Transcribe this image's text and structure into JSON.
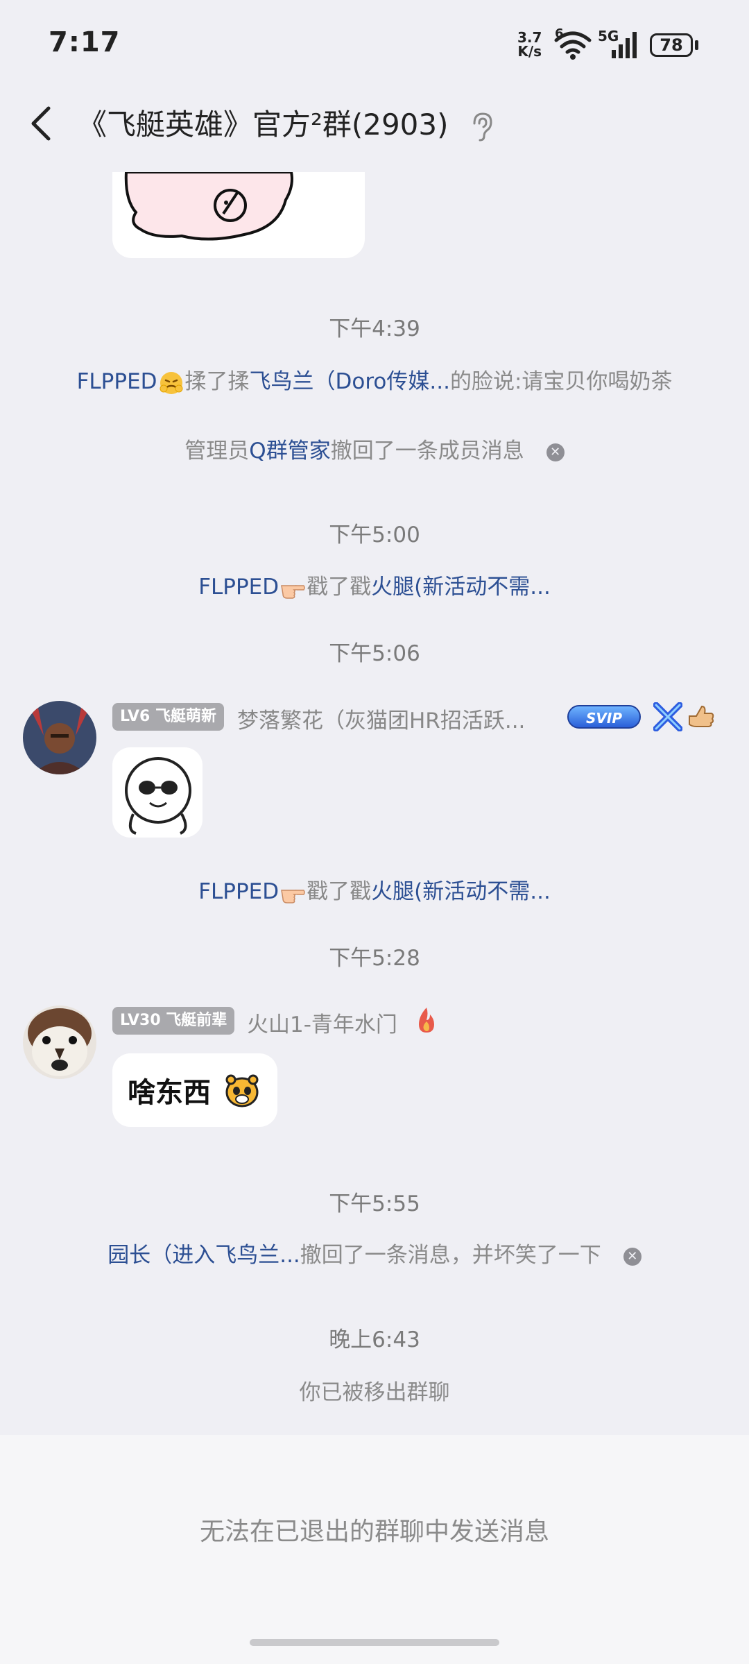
{
  "status_bar": {
    "time": "7:17",
    "net_speed_value": "3.7",
    "net_speed_unit": "K/s",
    "signal_label": "5G",
    "wifi_label": "6",
    "battery": "78"
  },
  "header": {
    "title": "《飞艇英雄》官方²群(2903)"
  },
  "messages": {
    "t1": "下午4:39",
    "nudge1": {
      "actor": "FLPPED",
      "action": "揉了揉",
      "target": "飞鸟兰（Doro传媒...",
      "suffix": "的脸说:请宝贝你喝奶茶"
    },
    "recall1": {
      "prefix": "管理员",
      "actor": "Q群管家",
      "suffix": "撤回了一条成员消息"
    },
    "t2": "下午5:00",
    "nudge2": {
      "actor": "FLPPED",
      "action": "戳了戳",
      "target": "火腿(新活动不需..."
    },
    "t3": "下午5:06",
    "msg1": {
      "badge": "LV6 飞艇萌新",
      "sender": "梦落繁花（灰猫团HR招活跃...",
      "vip_label": "SVIP"
    },
    "nudge3": {
      "actor": "FLPPED",
      "action": "戳了戳",
      "target": "火腿(新活动不需..."
    },
    "t4": "下午5:28",
    "msg2": {
      "badge": "LV30 飞艇前辈",
      "sender": "火山1-青年水门",
      "sticker_text": "啥东西"
    },
    "t5": "下午5:55",
    "recall2": {
      "actor": "园长（进入飞鸟兰...",
      "suffix": "撤回了一条消息，并坏笑了一下"
    },
    "t6": "晚上6:43",
    "removed": "你已被移出群聊"
  },
  "footer": {
    "disabled_notice": "无法在已退出的群聊中发送消息"
  }
}
